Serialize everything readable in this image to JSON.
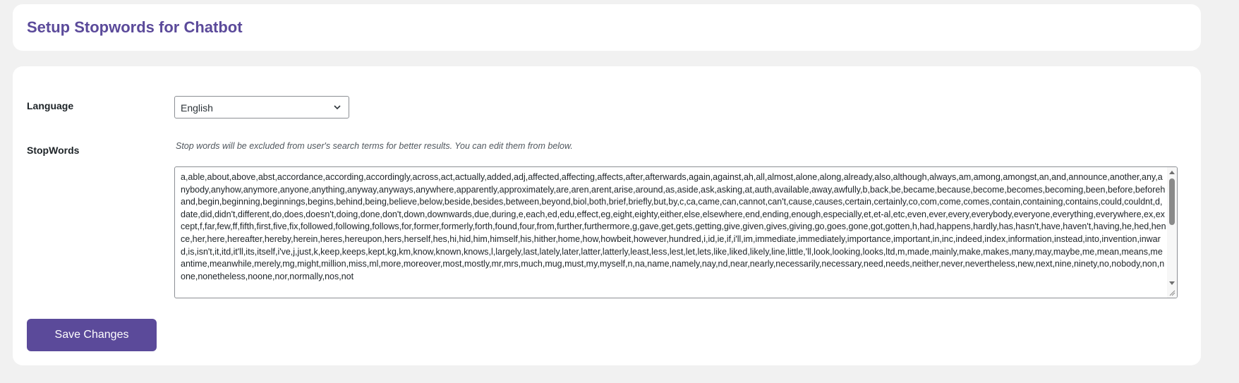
{
  "header": {
    "title": "Setup Stopwords for Chatbot"
  },
  "form": {
    "language_label": "Language",
    "language_value": "English",
    "stopwords_label": "StopWords",
    "stopwords_hint": "Stop words will be excluded from user's search terms for better results. You can edit them from below.",
    "stopwords_text": "a,able,about,above,abst,accordance,according,accordingly,across,act,actually,added,adj,affected,affecting,affects,after,afterwards,again,against,ah,all,almost,alone,along,already,also,although,always,am,among,amongst,an,and,announce,another,any,anybody,anyhow,anymore,anyone,anything,anyway,anyways,anywhere,apparently,approximately,are,aren,arent,arise,around,as,aside,ask,asking,at,auth,available,away,awfully,b,back,be,became,because,become,becomes,becoming,been,before,beforehand,begin,beginning,beginnings,begins,behind,being,believe,below,beside,besides,between,beyond,biol,both,brief,briefly,but,by,c,ca,came,can,cannot,can't,cause,causes,certain,certainly,co,com,come,comes,contain,containing,contains,could,couldnt,d,date,did,didn't,different,do,does,doesn't,doing,done,don't,down,downwards,due,during,e,each,ed,edu,effect,eg,eight,eighty,either,else,elsewhere,end,ending,enough,especially,et,et-al,etc,even,ever,every,everybody,everyone,everything,everywhere,ex,except,f,far,few,ff,fifth,first,five,fix,followed,following,follows,for,former,formerly,forth,found,four,from,further,furthermore,g,gave,get,gets,getting,give,given,gives,giving,go,goes,gone,got,gotten,h,had,happens,hardly,has,hasn't,have,haven't,having,he,hed,hence,her,here,hereafter,hereby,herein,heres,hereupon,hers,herself,hes,hi,hid,him,himself,his,hither,home,how,howbeit,however,hundred,i,id,ie,if,i'll,im,immediate,immediately,importance,important,in,inc,indeed,index,information,instead,into,invention,inward,is,isn't,it,itd,it'll,its,itself,i've,j,just,k,keep,keeps,kept,kg,km,know,known,knows,l,largely,last,lately,later,latter,latterly,least,less,lest,let,lets,like,liked,likely,line,little,'ll,look,looking,looks,ltd,m,made,mainly,make,makes,many,may,maybe,me,mean,means,meantime,meanwhile,merely,mg,might,million,miss,ml,more,moreover,most,mostly,mr,mrs,much,mug,must,my,myself,n,na,name,namely,nay,nd,near,nearly,necessarily,necessary,need,needs,neither,never,nevertheless,new,next,nine,ninety,no,nobody,non,none,nonetheless,noone,nor,normally,nos,not"
  },
  "actions": {
    "save_label": "Save Changes"
  },
  "colors": {
    "accent": "#5b4a9a",
    "background": "#f1f1f1",
    "card": "#ffffff"
  }
}
